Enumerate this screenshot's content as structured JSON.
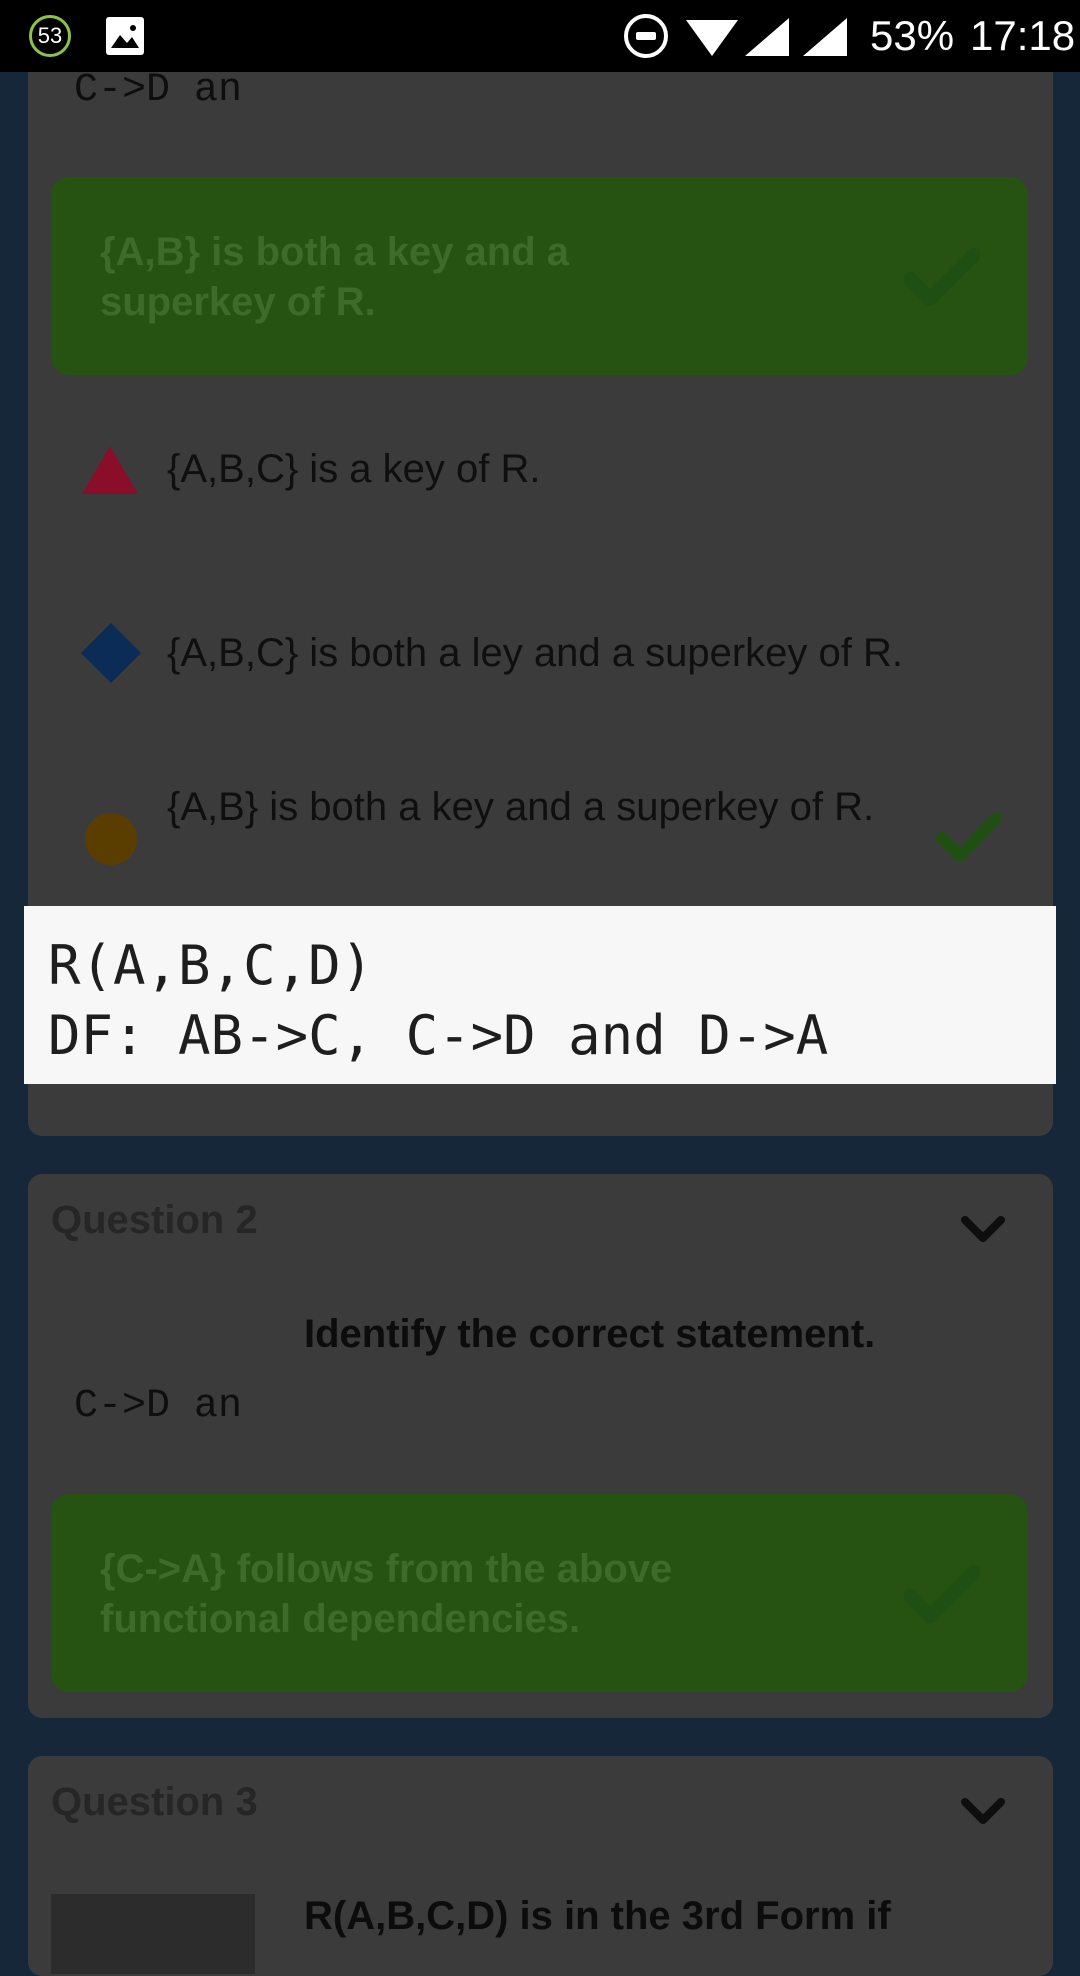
{
  "status_bar": {
    "notification_count": "53",
    "battery": "53%",
    "time": "17:18"
  },
  "question1": {
    "snippet": "C->D an",
    "correct_answer": "{A,B} is both a key and a superkey of R.",
    "options": [
      {
        "shape": "triangle",
        "color": "#8a0d2a",
        "text": "{A,B,C} is a key of R."
      },
      {
        "shape": "diamond",
        "color": "#0b2c56",
        "text": "{A,B,C} is both a ley and a superkey of R."
      },
      {
        "shape": "circle",
        "color": "#5a3e00",
        "text": "{A,B} is both a key and a superkey of R."
      }
    ]
  },
  "popup": {
    "line1": "R(A,B,C,D)",
    "line2": "DF: AB->C, C->D and D->A"
  },
  "question2": {
    "header": "Question 2",
    "title": "Identify the correct statement.",
    "snippet": "C->D an",
    "correct_answer": "{C->A} follows from the above functional dependencies."
  },
  "question3": {
    "header": "Question 3",
    "title_partial": "R(A,B,C,D) is in the 3rd Form if"
  },
  "colors": {
    "background": "#16273a",
    "card": "#3b3b3b",
    "answer_box": "#265212",
    "check_dark": "#1f4f12"
  }
}
